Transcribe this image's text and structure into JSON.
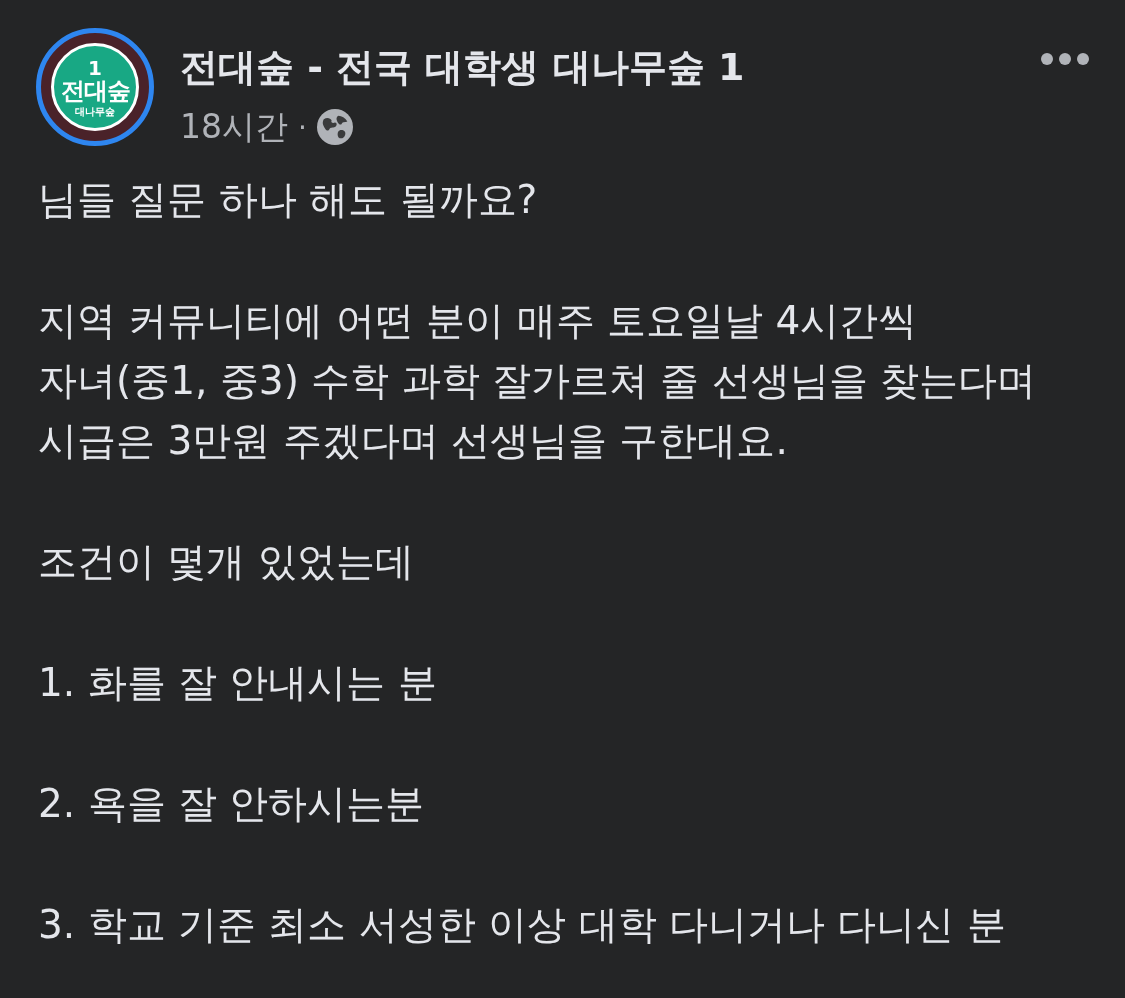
{
  "post": {
    "author": {
      "name": "전대숲 - 전국 대학생 대나무숲 1",
      "avatar": {
        "number": "1",
        "title": "전대숲",
        "subtitle": "대나무숲"
      }
    },
    "time": "18시간",
    "separator": "·",
    "audience": {
      "kind": "public"
    }
  },
  "paragraphs": [
    "님들 질문 하나 해도 될까요?",
    "지역 커뮤니티에 어떤 분이 매주 토요일날 4시간씩\n자녀(중1, 중3) 수학 과학 잘가르쳐 줄 선생님을 찾는다며\n시급은 3만원 주겠다며 선생님을 구한대요.",
    "조건이 몇개 있었는데",
    "1. 화를 잘 안내시는 분",
    "2. 욕을 잘 안하시는분",
    "3. 학교 기준 최소 서성한 이상 대학 다니거나 다니신 분"
  ]
}
